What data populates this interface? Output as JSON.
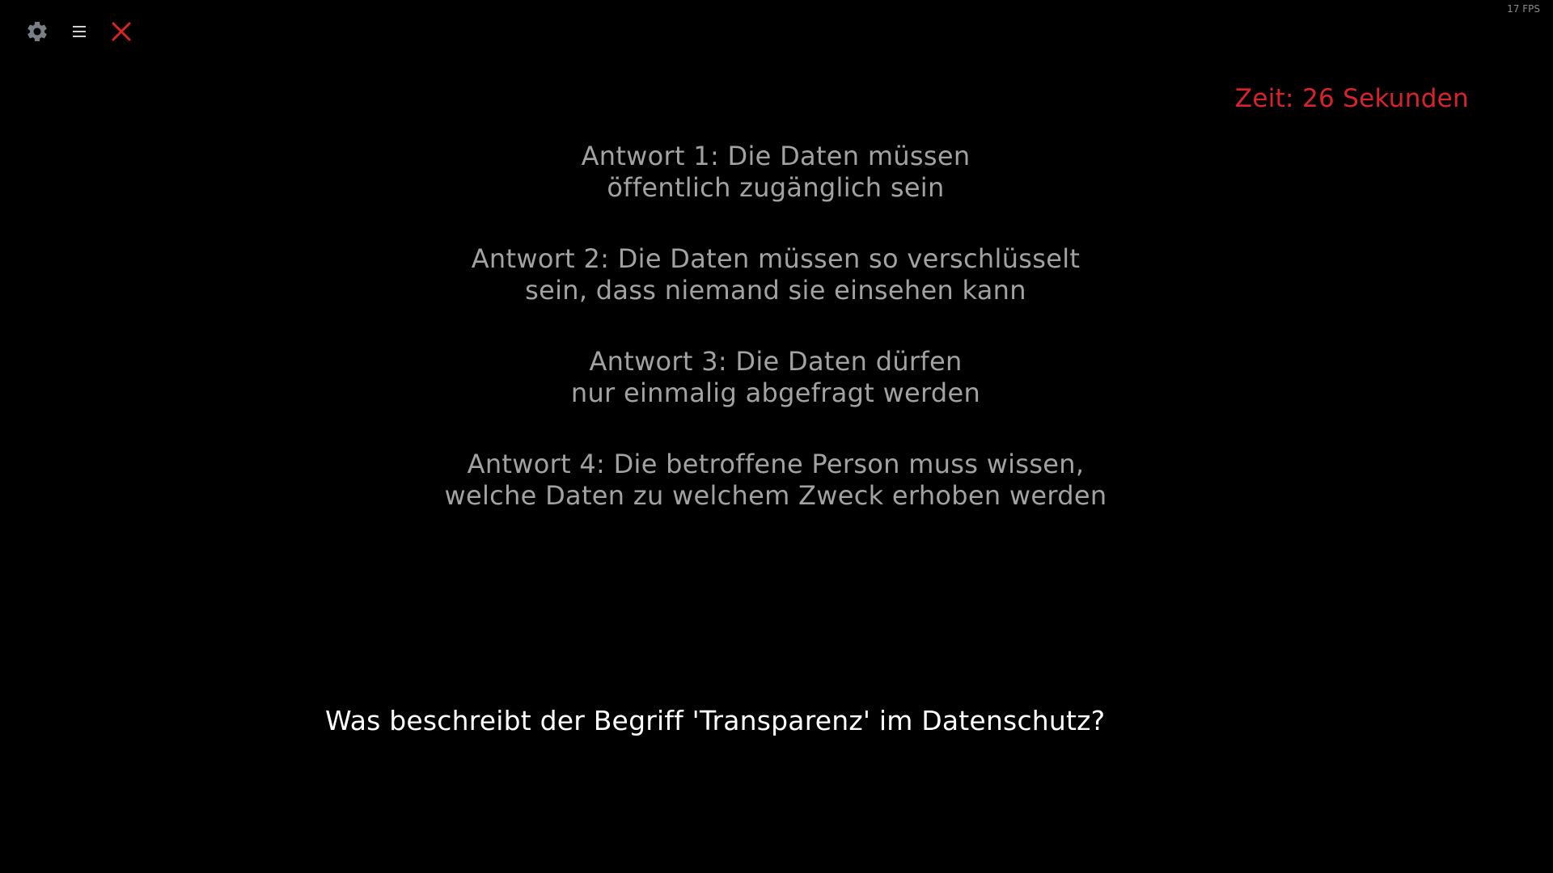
{
  "hud": {
    "fps": "17 FPS",
    "timer": "Zeit: 26 Sekunden"
  },
  "toolbar": {
    "icons": [
      "gear-icon",
      "hamburger-menu-icon",
      "close-icon"
    ],
    "close_color": "#d9232a",
    "icon_color": "#7a7f87"
  },
  "quiz": {
    "answers": [
      {
        "line1": "Antwort 1: Die Daten müssen",
        "line2": "öffentlich zugänglich sein"
      },
      {
        "line1": "Antwort 2: Die Daten müssen so verschlüsselt",
        "line2": "sein, dass niemand sie einsehen kann"
      },
      {
        "line1": "Antwort 3: Die Daten dürfen",
        "line2": "nur einmalig abgefragt werden"
      },
      {
        "line1": "Antwort 4: Die betroffene Person muss wissen,",
        "line2": "welche Daten zu welchem Zweck erhoben werden"
      }
    ],
    "question": "Was beschreibt der Begriff 'Transparenz' im Datenschutz?"
  },
  "colors": {
    "background": "#000000",
    "answer_text": "#a2a2a2",
    "question_text": "#ffffff",
    "timer_text": "#d9232a"
  }
}
